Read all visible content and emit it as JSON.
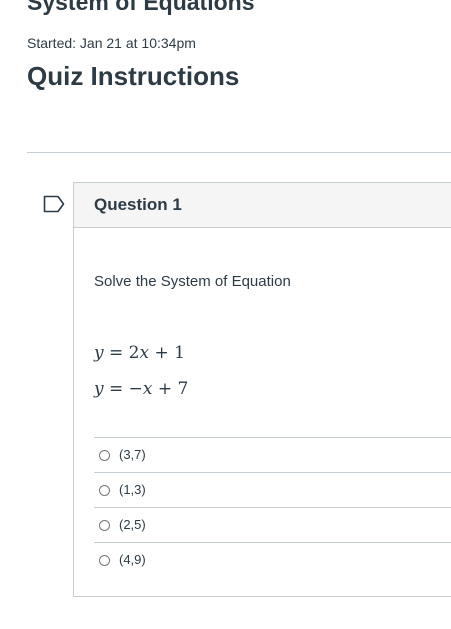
{
  "quiz": {
    "title": "System of Equations",
    "started": "Started: Jan 21 at 10:34pm",
    "instructions_heading": "Quiz Instructions"
  },
  "question": {
    "name": "Question 1",
    "flag_icon": "flag-outline-icon",
    "text": "Solve the System of Equation",
    "equations": [
      {
        "lhs": "y",
        "rest": " = 2",
        "var": "x",
        "tail": " + 1"
      },
      {
        "lhs": "y",
        "rest": " = −",
        "var": "x",
        "tail": " + 7"
      }
    ],
    "answers": [
      {
        "label": "(3,7)",
        "selected": false
      },
      {
        "label": "(1,3)",
        "selected": false
      },
      {
        "label": "(2,5)",
        "selected": false
      },
      {
        "label": "(4,9)",
        "selected": false
      }
    ]
  },
  "colors": {
    "text": "#2d3b45",
    "border": "#c7cdd1",
    "header_bg": "#f5f5f5"
  }
}
